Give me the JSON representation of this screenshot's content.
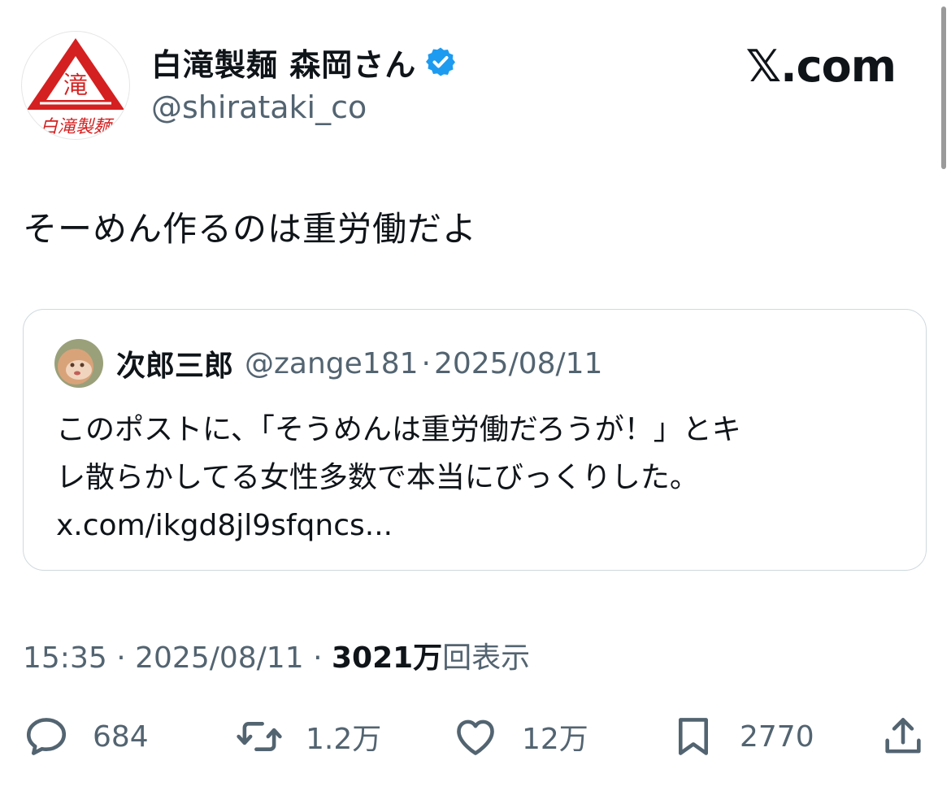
{
  "author": {
    "avatar_text": "滝",
    "avatar_caption": "白滝製麺",
    "display_name": "白滝製麺 森岡さん",
    "handle": "@shirataki_co",
    "verified": true
  },
  "brand": "𝕏.com",
  "tweet": {
    "text": "そーめん作るのは重労働だよ"
  },
  "quote": {
    "display_name": "次郎三郎",
    "handle": "@zange181",
    "separator": "·",
    "date": "2025/08/11",
    "lines": [
      "このポストに、「そうめんは重労働だろうが！」とキ",
      "レ散らかしてる女性多数で本当にびっくりした。",
      "x.com/ikgd8jl9sfqncs..."
    ]
  },
  "meta": {
    "time": "15:35",
    "sep1": "·",
    "date": "2025/08/11",
    "sep2": "·",
    "views_count": "3021万",
    "views_label": "回表示"
  },
  "actions": {
    "replies": "684",
    "reposts": "1.2万",
    "likes": "12万",
    "bookmarks": "2770"
  },
  "colors": {
    "text": "#0f1419",
    "secondary": "#536471",
    "verified": "#1d9bf0",
    "logo_red": "#d42020",
    "border": "#cfd9de"
  }
}
